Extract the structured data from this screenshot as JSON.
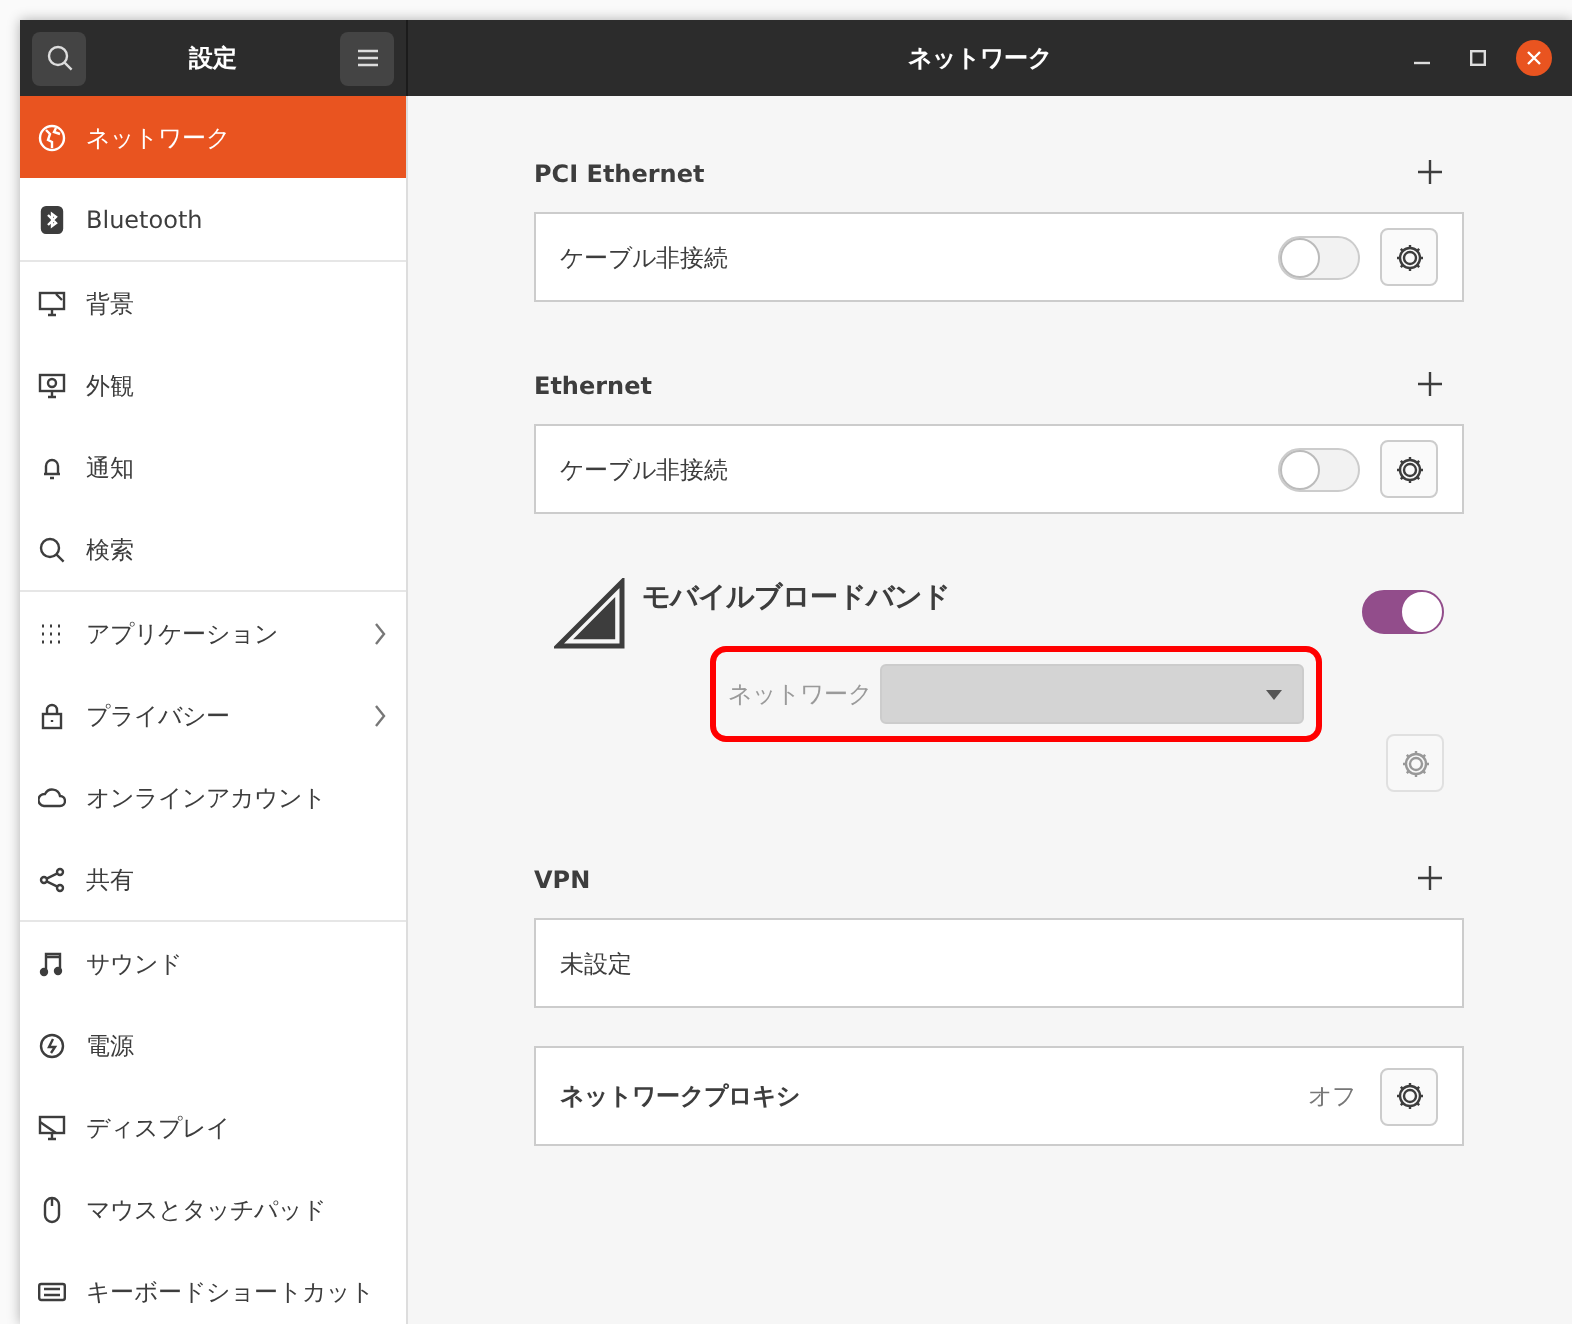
{
  "header": {
    "title": "設定"
  },
  "window": {
    "title": "ネットワーク"
  },
  "sidebar": {
    "groups": [
      [
        {
          "label": "ネットワーク",
          "selected": true,
          "arrow": false
        },
        {
          "label": "Bluetooth",
          "selected": false,
          "arrow": false
        }
      ],
      [
        {
          "label": "背景",
          "selected": false,
          "arrow": false
        },
        {
          "label": "外観",
          "selected": false,
          "arrow": false
        },
        {
          "label": "通知",
          "selected": false,
          "arrow": false
        },
        {
          "label": "検索",
          "selected": false,
          "arrow": false
        }
      ],
      [
        {
          "label": "アプリケーション",
          "selected": false,
          "arrow": true
        },
        {
          "label": "プライバシー",
          "selected": false,
          "arrow": true
        },
        {
          "label": "オンラインアカウント",
          "selected": false,
          "arrow": false
        },
        {
          "label": "共有",
          "selected": false,
          "arrow": false
        }
      ],
      [
        {
          "label": "サウンド",
          "selected": false,
          "arrow": false
        },
        {
          "label": "電源",
          "selected": false,
          "arrow": false
        },
        {
          "label": "ディスプレイ",
          "selected": false,
          "arrow": false
        },
        {
          "label": "マウスとタッチパッド",
          "selected": false,
          "arrow": false
        },
        {
          "label": "キーボードショートカット",
          "selected": false,
          "arrow": false
        }
      ]
    ]
  },
  "sections": [
    {
      "kind": "wired",
      "title": "PCI Ethernet",
      "rows": [
        {
          "label": "ケーブル非接続",
          "on": false
        }
      ]
    },
    {
      "kind": "wired",
      "title": "Ethernet",
      "rows": [
        {
          "label": "ケーブル非接続",
          "on": false
        }
      ]
    },
    {
      "kind": "mobile",
      "title": "モバイルブロードバンド",
      "on": true,
      "network_label": "ネットワーク",
      "disabled": true,
      "highlighted": true
    },
    {
      "kind": "vpn",
      "title": "VPN",
      "rows": [
        {
          "label": "未設定"
        }
      ]
    },
    {
      "kind": "proxy",
      "label": "ネットワークプロキシ",
      "value": "オフ"
    }
  ]
}
